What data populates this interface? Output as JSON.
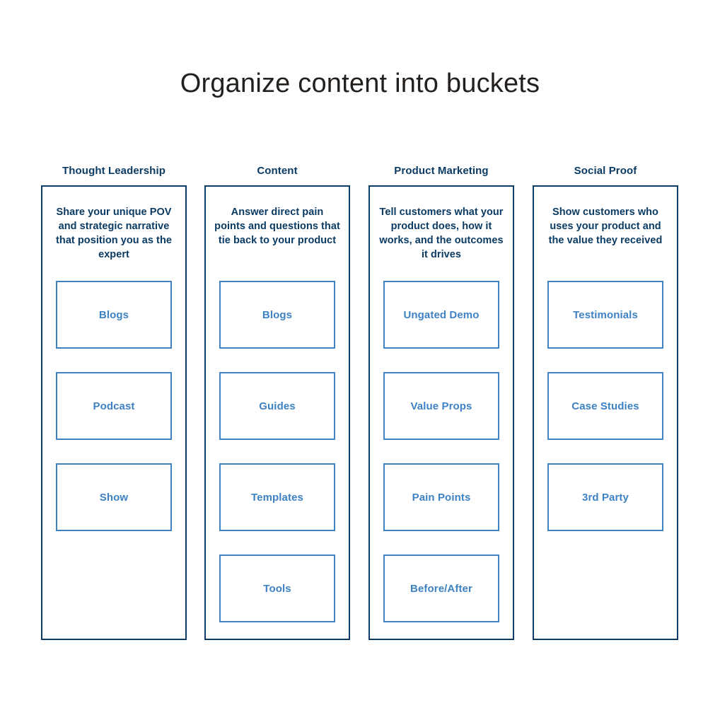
{
  "title": "Organize content into buckets",
  "colors": {
    "title": "#231f1c",
    "container_border": "#0b3b63",
    "header_text": "#0b3b63",
    "description_text": "#0b3b63",
    "item_border": "#3e82c4",
    "item_text": "#3e82c4",
    "background": "#ffffff"
  },
  "columns": [
    {
      "header": "Thought Leadership",
      "description": "Share your unique POV and strategic narrative that position you as the expert",
      "items": [
        {
          "label": "Blogs"
        },
        {
          "label": "Podcast"
        },
        {
          "label": "Show"
        }
      ]
    },
    {
      "header": "Content",
      "description": "Answer direct pain points and questions that tie back to your product",
      "items": [
        {
          "label": "Blogs"
        },
        {
          "label": "Guides"
        },
        {
          "label": "Templates"
        },
        {
          "label": "Tools"
        }
      ]
    },
    {
      "header": "Product Marketing",
      "description": "Tell customers what your product does, how it works, and the outcomes it drives",
      "items": [
        {
          "label": "Ungated Demo"
        },
        {
          "label": "Value Props"
        },
        {
          "label": "Pain Points"
        },
        {
          "label": "Before/After"
        }
      ]
    },
    {
      "header": "Social Proof",
      "description": "Show customers who uses your product and the value they received",
      "items": [
        {
          "label": "Testimonials"
        },
        {
          "label": "Case Studies"
        },
        {
          "label": "3rd Party"
        }
      ]
    }
  ]
}
